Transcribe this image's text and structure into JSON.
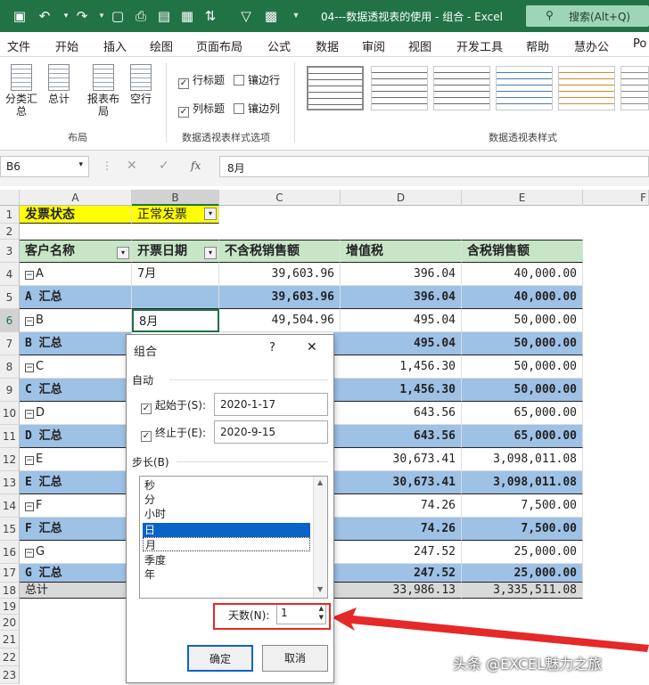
{
  "titlebar": {
    "doc_title": "04---数据透视表的使用 - 组合  -  Excel",
    "search_placeholder": "搜索(Alt+Q)"
  },
  "tabs": [
    "文件",
    "开始",
    "插入",
    "绘图",
    "页面布局",
    "公式",
    "数据",
    "审阅",
    "视图",
    "开发工具",
    "帮助",
    "慧办公",
    "Po"
  ],
  "ribbon": {
    "subtotals": "分类汇总",
    "totals": "总计",
    "report_layout": "报表布局",
    "blank_rows": "空行",
    "layout_group": "布局",
    "row_headers": "行标题",
    "banded_rows": "镶边行",
    "col_headers": "列标题",
    "banded_cols": "镶边列",
    "style_options_group": "数据透视表样式选项",
    "styles_group": "数据透视表样式"
  },
  "formula_bar": {
    "name_box": "B6",
    "formula": "8月",
    "fx_label": "fx"
  },
  "columns": [
    "A",
    "B",
    "C",
    "D",
    "E",
    "F"
  ],
  "rows": [
    "1",
    "2",
    "3",
    "4",
    "5",
    "6",
    "7",
    "8",
    "9",
    "10",
    "11",
    "12",
    "13",
    "14",
    "15",
    "16",
    "17",
    "18",
    "19",
    "20",
    "21",
    "22",
    "23"
  ],
  "sheet": {
    "filter_label": "发票状态",
    "filter_value": "正常发票",
    "headers": [
      "客户名称",
      "开票日期",
      "不含税销售额",
      "增值税",
      "含税销售额"
    ],
    "data": [
      {
        "a": "A",
        "b": "7月",
        "c": "39,603.96",
        "d": "396.04",
        "e": "40,000.00"
      },
      {
        "a": "A 汇总",
        "b": "",
        "c": "39,603.96",
        "d": "396.04",
        "e": "40,000.00"
      },
      {
        "a": "B",
        "b": "8月",
        "c": "49,504.96",
        "d": "495.04",
        "e": "50,000.00"
      },
      {
        "a": "B 汇总",
        "b": "",
        "c": "",
        "d": "495.04",
        "e": "50,000.00"
      },
      {
        "a": "C",
        "b": "",
        "c": "",
        "d": "1,456.30",
        "e": "50,000.00"
      },
      {
        "a": "C 汇总",
        "b": "",
        "c": "",
        "d": "1,456.30",
        "e": "50,000.00"
      },
      {
        "a": "D",
        "b": "",
        "c": "",
        "d": "643.56",
        "e": "65,000.00"
      },
      {
        "a": "D 汇总",
        "b": "",
        "c": "",
        "d": "643.56",
        "e": "65,000.00"
      },
      {
        "a": "E",
        "b": "",
        "c": "",
        "d": "30,673.41",
        "e": "3,098,011.08"
      },
      {
        "a": "E 汇总",
        "b": "",
        "c": "",
        "d": "30,673.41",
        "e": "3,098,011.08"
      },
      {
        "a": "F",
        "b": "",
        "c": "",
        "d": "74.26",
        "e": "7,500.00"
      },
      {
        "a": "F 汇总",
        "b": "",
        "c": "",
        "d": "74.26",
        "e": "7,500.00"
      },
      {
        "a": "G",
        "b": "",
        "c": "",
        "d": "247.52",
        "e": "25,000.00"
      },
      {
        "a": "G 汇总",
        "b": "",
        "c": "",
        "d": "247.52",
        "e": "25,000.00"
      },
      {
        "a": "总计",
        "b": "",
        "c": "",
        "d": "33,986.13",
        "e": "3,335,511.08"
      }
    ]
  },
  "dialog": {
    "title": "组合",
    "help": "?",
    "close": "✕",
    "auto_section": "自动",
    "start_label": "起始于(S):",
    "start_value": "2020-1-17",
    "end_label": "终止于(E):",
    "end_value": "2020-9-15",
    "step_label": "步长(B)",
    "list_items": [
      "秒",
      "分",
      "小时",
      "日",
      "月",
      "季度",
      "年"
    ],
    "selected_item": "日",
    "days_label": "天数(N):",
    "days_value": "1",
    "ok": "确定",
    "cancel": "取消"
  },
  "watermark": "头条 @EXCEL魅力之旅",
  "colors": {
    "accent": "#217346",
    "highlight": "#e62828",
    "subtotal_row": "#9ec1e6",
    "header_row": "#c6e6c6"
  }
}
